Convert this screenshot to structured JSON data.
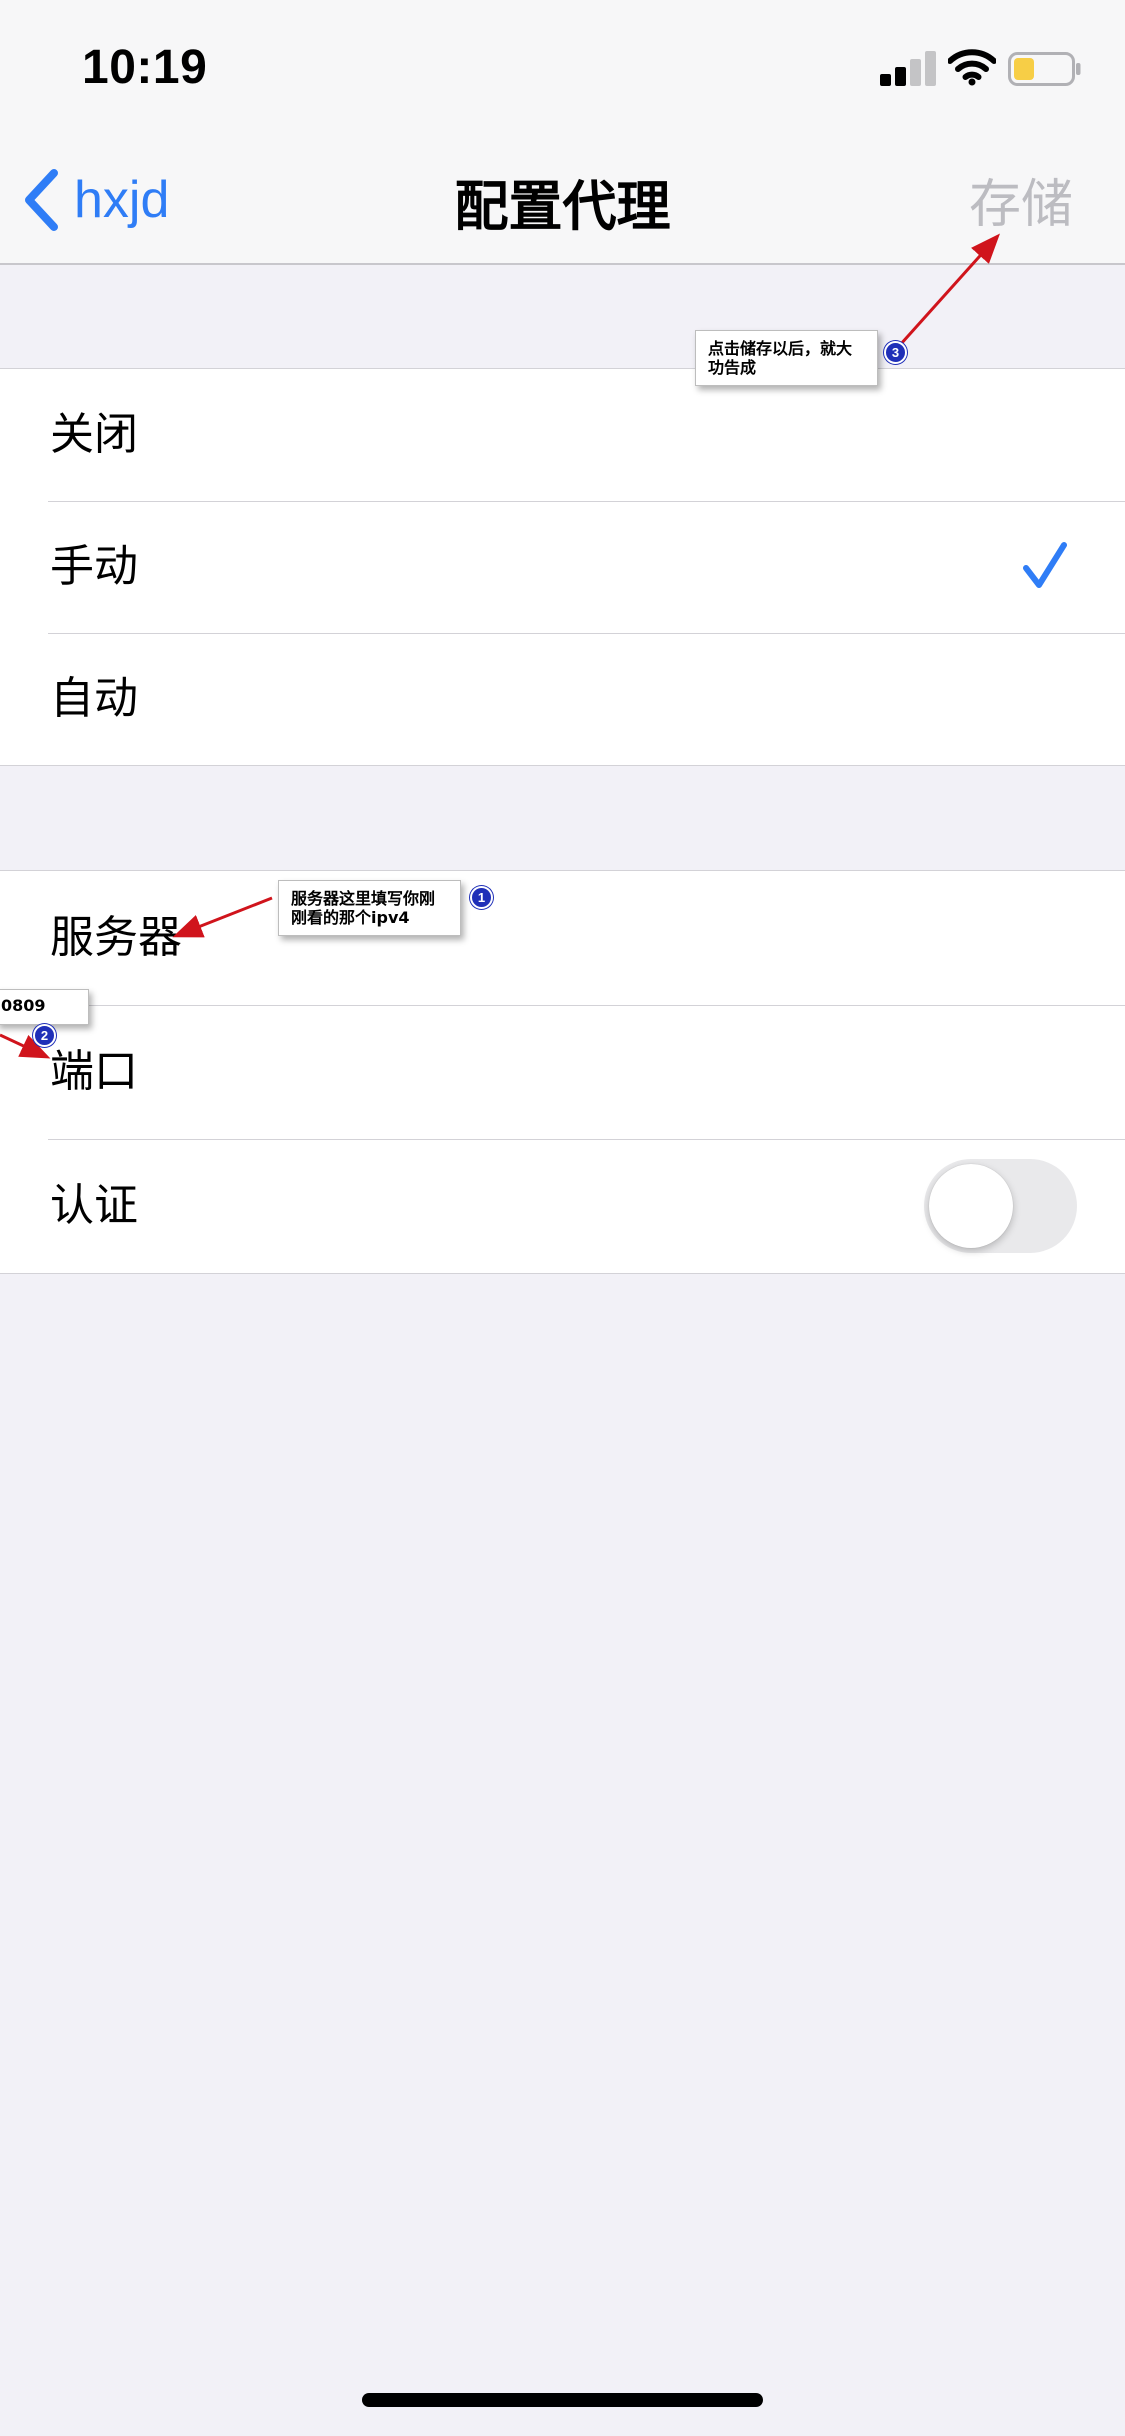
{
  "status_bar": {
    "time": "10:19",
    "icons": [
      "signal-icon",
      "wifi-icon",
      "battery-icon"
    ],
    "battery_color": "#f7ce46"
  },
  "nav": {
    "back_label": "hxjd",
    "title": "配置代理",
    "save_label": "存储",
    "accent_color": "#2f7df6"
  },
  "proxy_modes": {
    "options": [
      {
        "label": "关闭",
        "selected": false
      },
      {
        "label": "手动",
        "selected": true
      },
      {
        "label": "自动",
        "selected": false
      }
    ]
  },
  "manual_settings": {
    "server_label": "服务器",
    "port_label": "端口",
    "auth_label": "认证",
    "auth_enabled": false
  },
  "annotations": {
    "save_note": {
      "number": "3",
      "text": "点击储存以后，就大功告成"
    },
    "server_note": {
      "number": "1",
      "text": "服务器这里填写你刚刚看的那个ipv4"
    },
    "port_note": {
      "number": "2",
      "text": "0809"
    }
  }
}
